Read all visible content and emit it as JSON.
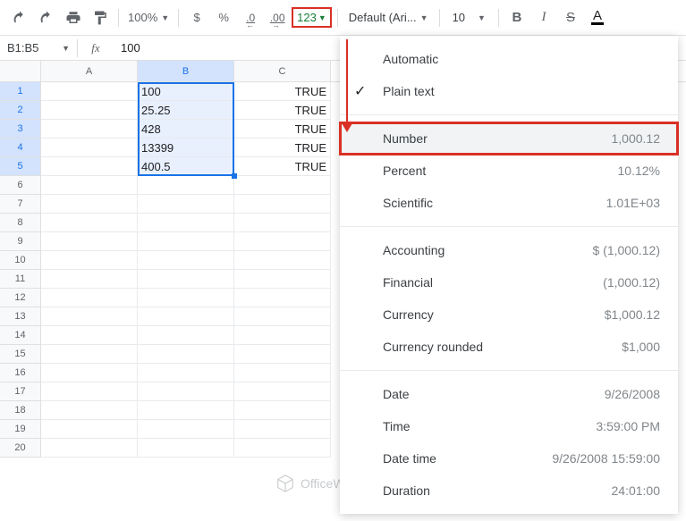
{
  "toolbar": {
    "zoom": "100%",
    "dec_dec": ".0",
    "inc_dec": ".00",
    "format_btn": "123",
    "font": "Default (Ari...",
    "size": "10",
    "bold": "B",
    "italic": "I",
    "strike": "S",
    "textcolor": "A"
  },
  "namebox": "B1:B5",
  "fx_value": "100",
  "columns": [
    "A",
    "B",
    "C"
  ],
  "row_numbers": [
    "1",
    "2",
    "3",
    "4",
    "5",
    "6",
    "7",
    "8",
    "9",
    "10",
    "11",
    "12",
    "13",
    "14",
    "15",
    "16",
    "17",
    "18",
    "19",
    "20"
  ],
  "cells": {
    "b": [
      "100",
      "25.25",
      "428",
      "13399",
      "400.5"
    ],
    "c": [
      "TRUE",
      "TRUE",
      "TRUE",
      "TRUE",
      "TRUE"
    ]
  },
  "dropdown": {
    "automatic": "Automatic",
    "plaintext": "Plain text",
    "groups": [
      [
        {
          "label": "Number",
          "example": "1,000.12",
          "hl": true
        },
        {
          "label": "Percent",
          "example": "10.12%"
        },
        {
          "label": "Scientific",
          "example": "1.01E+03"
        }
      ],
      [
        {
          "label": "Accounting",
          "example": "$ (1,000.12)"
        },
        {
          "label": "Financial",
          "example": "(1,000.12)"
        },
        {
          "label": "Currency",
          "example": "$1,000.12"
        },
        {
          "label": "Currency rounded",
          "example": "$1,000"
        }
      ],
      [
        {
          "label": "Date",
          "example": "9/26/2008"
        },
        {
          "label": "Time",
          "example": "3:59:00 PM"
        },
        {
          "label": "Date time",
          "example": "9/26/2008 15:59:00"
        },
        {
          "label": "Duration",
          "example": "24:01:00"
        }
      ]
    ]
  },
  "watermark": "OfficeWheel"
}
